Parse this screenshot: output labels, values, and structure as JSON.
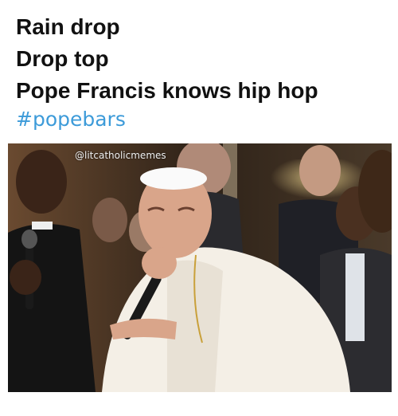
{
  "caption": {
    "lines": [
      "Rain drop",
      "Drop top",
      "Pope Francis knows hip hop"
    ],
    "hashtag": "#popebars"
  },
  "photo": {
    "watermark": "@litcatholicmemes",
    "description_icon": "pope-with-microphone"
  },
  "colors": {
    "hashtag": "#3d9bd9",
    "text": "#111111",
    "background": "#ffffff"
  }
}
